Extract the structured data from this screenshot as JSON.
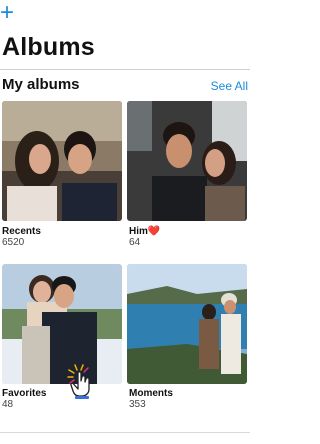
{
  "header": {
    "add_symbol": "+",
    "title": "Albums"
  },
  "my_albums": {
    "title": "My albums",
    "see_all": "See All",
    "albums": [
      {
        "name": "Recents",
        "count": "6520"
      },
      {
        "name": "Him❤️",
        "count": "64"
      },
      {
        "name": "Favorites",
        "count": "48"
      },
      {
        "name": "Moments",
        "count": "353"
      }
    ]
  },
  "colors": {
    "accent": "#1a8cd8",
    "heart": "#e0604b"
  },
  "icons": {
    "add": "plus-icon",
    "cursor": "hand-pointer-icon"
  }
}
